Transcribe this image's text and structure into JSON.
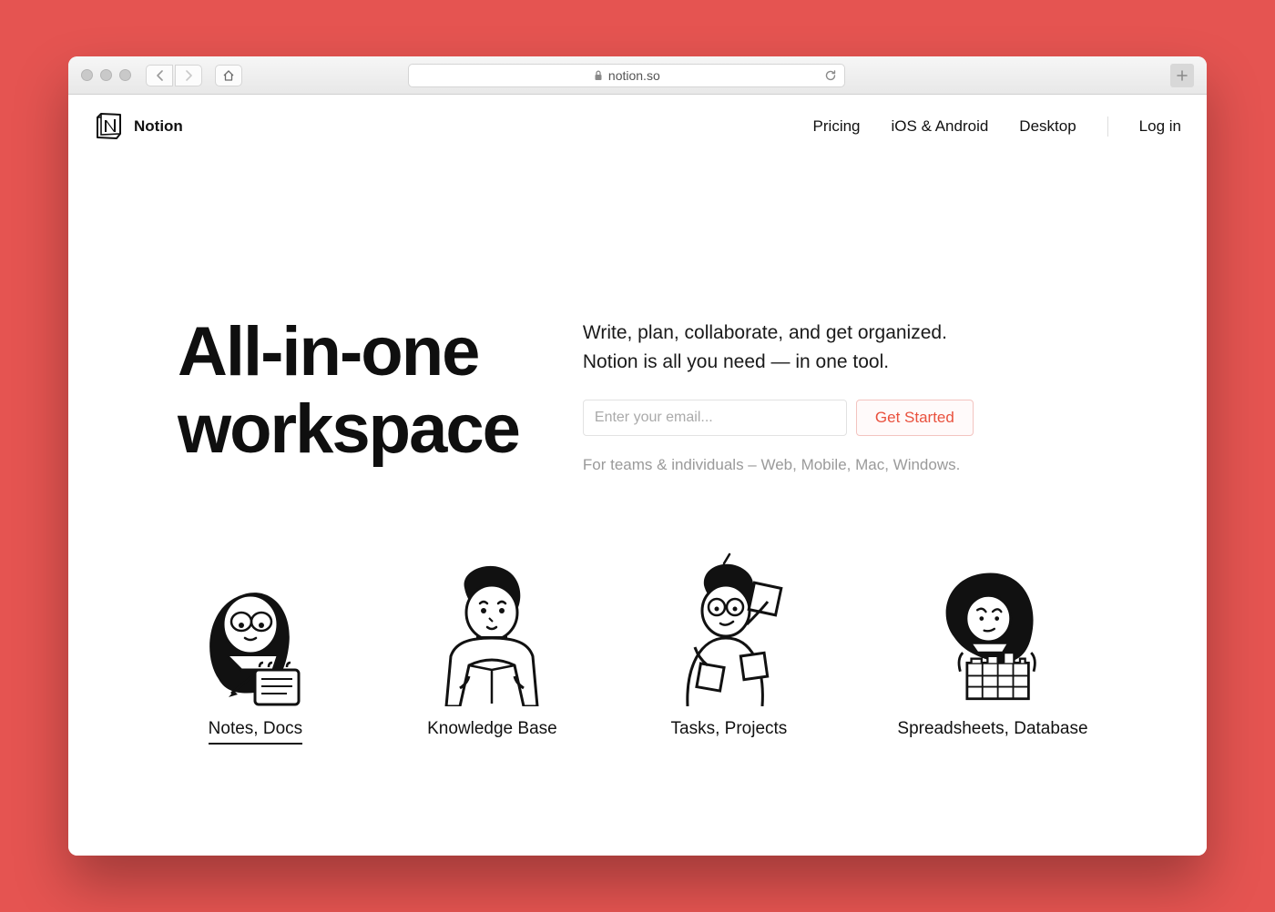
{
  "browser": {
    "url_host": "notion.so"
  },
  "header": {
    "brand_name": "Notion",
    "nav_items": [
      "Pricing",
      "iOS & Android",
      "Desktop"
    ],
    "login_label": "Log in"
  },
  "hero": {
    "title_line1": "All-in-one",
    "title_line2": "workspace",
    "subtitle_line1": "Write, plan, collaborate, and get organized.",
    "subtitle_line2": "Notion is all you need — in one tool.",
    "email_placeholder": "Enter your email...",
    "cta_label": "Get Started",
    "platforms_text": "For teams & individuals – Web, Mobile, Mac, Windows."
  },
  "features": [
    {
      "label": "Notes, Docs",
      "active": true
    },
    {
      "label": "Knowledge Base",
      "active": false
    },
    {
      "label": "Tasks, Projects",
      "active": false
    },
    {
      "label": "Spreadsheets, Database",
      "active": false
    }
  ]
}
